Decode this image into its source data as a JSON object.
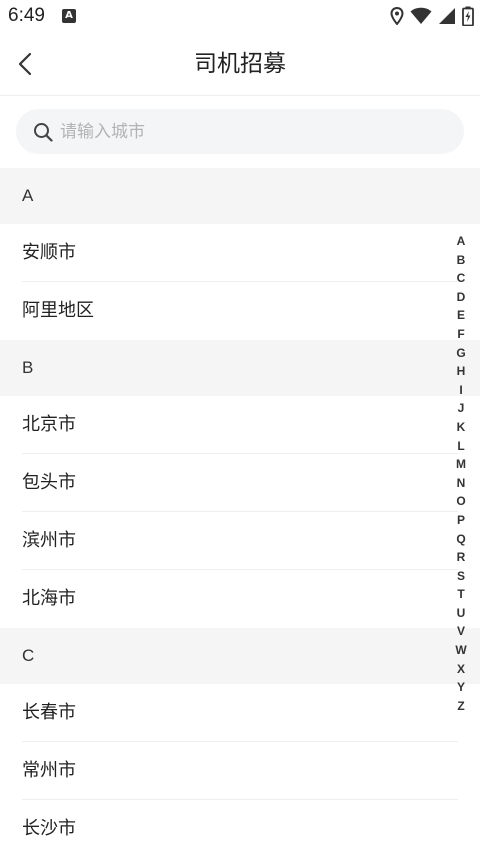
{
  "status_bar": {
    "time": "6:49",
    "notification_icon_letter": "A"
  },
  "header": {
    "title": "司机招募"
  },
  "search": {
    "placeholder": "请输入城市",
    "value": ""
  },
  "sections": [
    {
      "letter": "A",
      "cities": [
        "安顺市",
        "阿里地区"
      ]
    },
    {
      "letter": "B",
      "cities": [
        "北京市",
        "包头市",
        "滨州市",
        "北海市"
      ]
    },
    {
      "letter": "C",
      "cities": [
        "长春市",
        "常州市",
        "长沙市"
      ]
    }
  ],
  "alphabet_index": [
    "A",
    "B",
    "C",
    "D",
    "E",
    "F",
    "G",
    "H",
    "I",
    "J",
    "K",
    "L",
    "M",
    "N",
    "O",
    "P",
    "Q",
    "R",
    "S",
    "T",
    "U",
    "V",
    "W",
    "X",
    "Y",
    "Z"
  ],
  "colors": {
    "background": "#ffffff",
    "section_header_bg": "#f5f5f5",
    "search_bg": "#f4f5f7",
    "text_primary": "#222222",
    "placeholder": "#b3b3b3",
    "divider": "#eeeeee"
  },
  "icons": {
    "back": "chevron-left-icon",
    "search": "magnifier-icon",
    "location": "location-pin-icon",
    "wifi": "wifi-icon",
    "signal": "signal-icon",
    "battery": "battery-charging-icon"
  }
}
